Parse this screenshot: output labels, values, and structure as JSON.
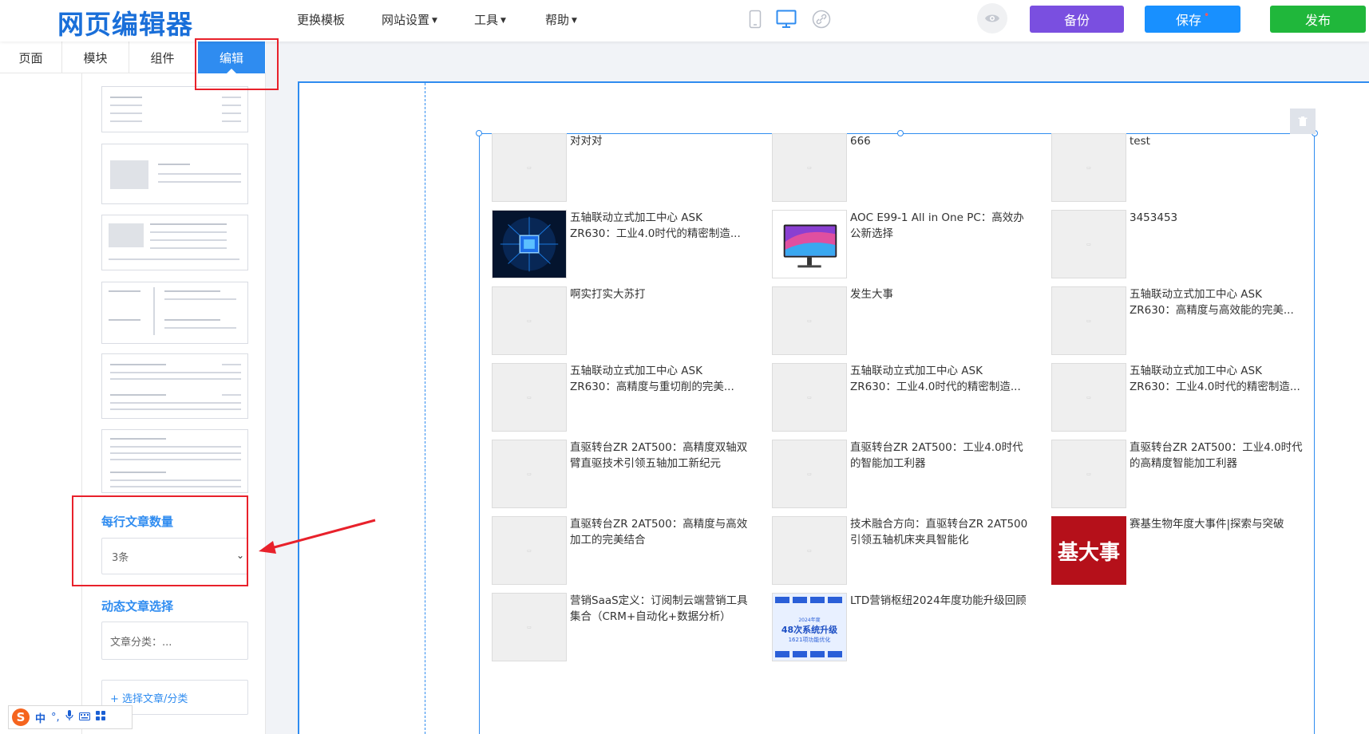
{
  "app": {
    "logo": "网页编辑器",
    "menu": [
      {
        "label": "更换模板",
        "caret": false
      },
      {
        "label": "网站设置",
        "caret": true
      },
      {
        "label": "工具",
        "caret": true
      },
      {
        "label": "帮助",
        "caret": true
      }
    ],
    "devices": [
      "mobile-icon",
      "desktop-icon",
      "link-icon"
    ],
    "buttons": {
      "backup": "备份",
      "save": "保存",
      "save_dot": "•",
      "publish": "发布"
    },
    "colors": {
      "accent": "#2f8cf0",
      "backup": "#7a4fe0",
      "save": "#1890ff",
      "publish": "#20b73b",
      "highlight": "#e8212b"
    }
  },
  "sidebar": {
    "tabs": [
      "页面",
      "模块",
      "组件",
      "编辑"
    ],
    "active_tab": "编辑",
    "per_row_label": "每行文章数量",
    "per_row_value": "3条",
    "dynamic_label": "动态文章选择",
    "category_value": "文章分类：...",
    "add_label": "+ 选择文章/分类"
  },
  "ime": {
    "mode": "中",
    "punct": "°,"
  },
  "articles": [
    {
      "title": "对对对",
      "image": "placeholder"
    },
    {
      "title": "666",
      "image": "placeholder"
    },
    {
      "title": "test",
      "image": "placeholder"
    },
    {
      "title": "五轴联动立式加工中心 ASK ZR630：工业4.0时代的精密制造...",
      "image": "chip"
    },
    {
      "title": "AOC E99-1 All in One PC：高效办公新选择",
      "image": "monitor"
    },
    {
      "title": "3453453",
      "image": "placeholder"
    },
    {
      "title": "啊实打实大苏打",
      "image": "placeholder"
    },
    {
      "title": "发生大事",
      "image": "placeholder"
    },
    {
      "title": "五轴联动立式加工中心 ASK ZR630：高精度与高效能的完美...",
      "image": "placeholder"
    },
    {
      "title": "五轴联动立式加工中心 ASK ZR630：高精度与重切削的完美...",
      "image": "placeholder"
    },
    {
      "title": "五轴联动立式加工中心 ASK ZR630：工业4.0时代的精密制造...",
      "image": "placeholder"
    },
    {
      "title": "五轴联动立式加工中心 ASK ZR630：工业4.0时代的精密制造...",
      "image": "placeholder"
    },
    {
      "title": "直驱转台ZR 2AT500：高精度双轴双臂直驱技术引领五轴加工新纪元",
      "image": "placeholder"
    },
    {
      "title": "直驱转台ZR 2AT500：工业4.0时代的智能加工利器",
      "image": "placeholder"
    },
    {
      "title": "直驱转台ZR 2AT500：工业4.0时代的高精度智能加工利器",
      "image": "placeholder"
    },
    {
      "title": "直驱转台ZR 2AT500：高精度与高效加工的完美结合",
      "image": "placeholder"
    },
    {
      "title": "技术融合方向：直驱转台ZR 2AT500引领五轴机床夹具智能化",
      "image": "placeholder"
    },
    {
      "title": "赛基生物年度大事件|探索与突破",
      "image": "red",
      "image_text": "基大事"
    },
    {
      "title": "营销SaaS定义：订阅制云端营销工具集合（CRM+自动化+数据分析）",
      "image": "placeholder"
    },
    {
      "title": "LTD营销枢纽2024年度功能升级回顾",
      "image": "upgrade",
      "image_text": "48次系统升级",
      "image_subtext": "1621项功能优化",
      "image_year": "2024年度"
    }
  ]
}
